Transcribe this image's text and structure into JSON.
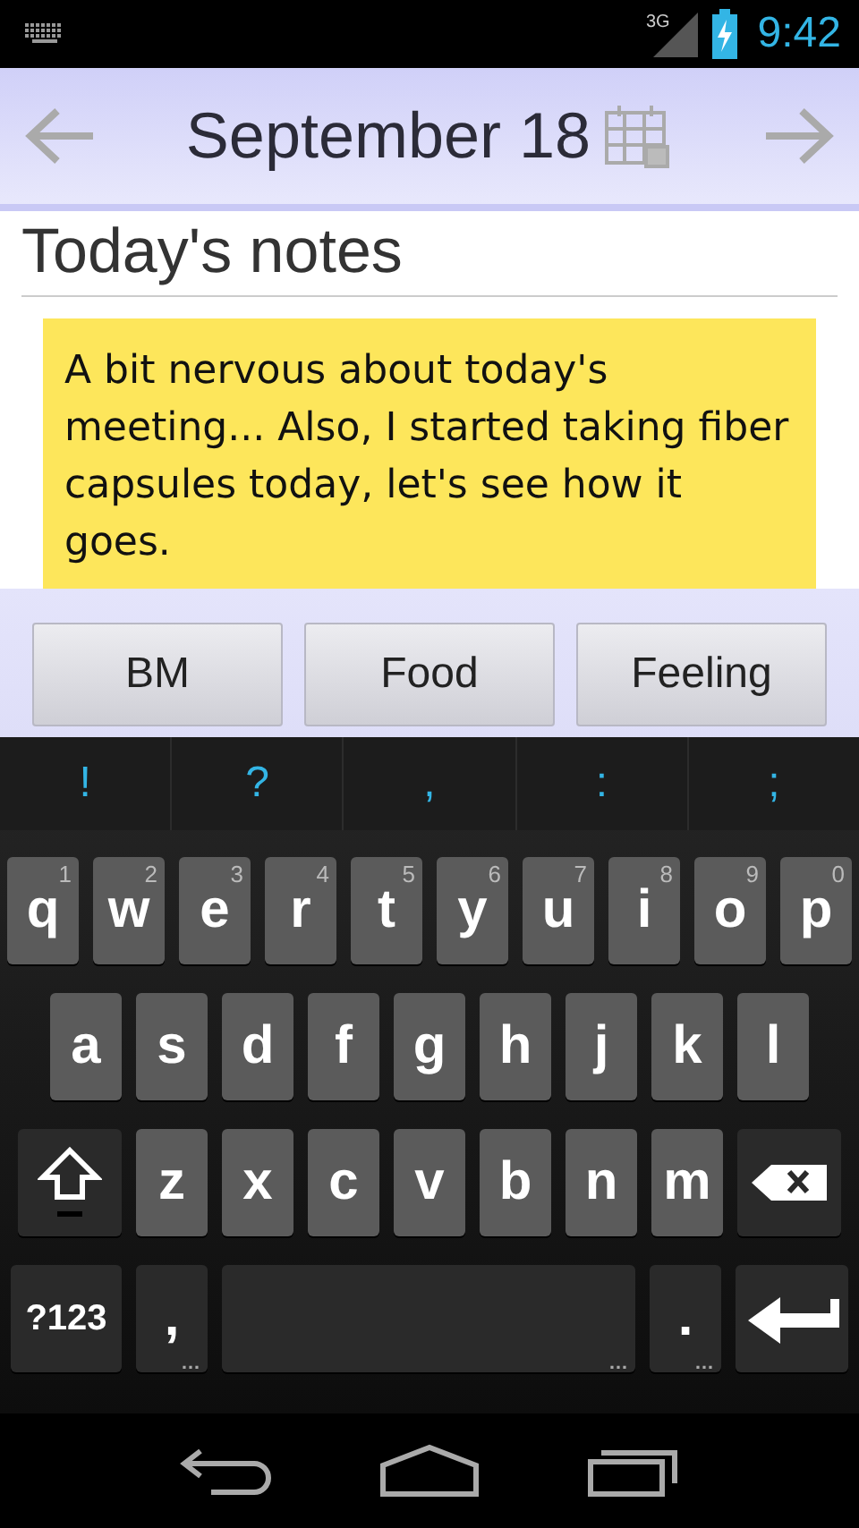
{
  "status_bar": {
    "time": "9:42",
    "network": "3G"
  },
  "header": {
    "title": "September 18"
  },
  "section_title": "Today's notes",
  "note": {
    "text": "A bit nervous about today's meeting... Also, I started taking fiber capsules today, let's see how it goes."
  },
  "category_buttons": [
    "BM",
    "Food",
    "Feeling"
  ],
  "suggestions": [
    "!",
    "?",
    ",",
    ":",
    ";"
  ],
  "keyboard": {
    "rows": [
      {
        "keys": [
          {
            "kind": "letter",
            "label": "q",
            "hint": "1"
          },
          {
            "kind": "letter",
            "label": "w",
            "hint": "2"
          },
          {
            "kind": "letter",
            "label": "e",
            "hint": "3"
          },
          {
            "kind": "letter",
            "label": "r",
            "hint": "4"
          },
          {
            "kind": "letter",
            "label": "t",
            "hint": "5"
          },
          {
            "kind": "letter",
            "label": "y",
            "hint": "6"
          },
          {
            "kind": "letter",
            "label": "u",
            "hint": "7"
          },
          {
            "kind": "letter",
            "label": "i",
            "hint": "8"
          },
          {
            "kind": "letter",
            "label": "o",
            "hint": "9"
          },
          {
            "kind": "letter",
            "label": "p",
            "hint": "0"
          }
        ]
      },
      {
        "keys": [
          {
            "kind": "letter",
            "label": "a"
          },
          {
            "kind": "letter",
            "label": "s"
          },
          {
            "kind": "letter",
            "label": "d"
          },
          {
            "kind": "letter",
            "label": "f"
          },
          {
            "kind": "letter",
            "label": "g"
          },
          {
            "kind": "letter",
            "label": "h"
          },
          {
            "kind": "letter",
            "label": "j"
          },
          {
            "kind": "letter",
            "label": "k"
          },
          {
            "kind": "letter",
            "label": "l"
          }
        ]
      },
      {
        "keys": [
          {
            "kind": "shift"
          },
          {
            "kind": "letter",
            "label": "z"
          },
          {
            "kind": "letter",
            "label": "x"
          },
          {
            "kind": "letter",
            "label": "c"
          },
          {
            "kind": "letter",
            "label": "v"
          },
          {
            "kind": "letter",
            "label": "b"
          },
          {
            "kind": "letter",
            "label": "n"
          },
          {
            "kind": "letter",
            "label": "m"
          },
          {
            "kind": "backspace"
          }
        ]
      },
      {
        "keys": [
          {
            "kind": "symbols",
            "label": "?123"
          },
          {
            "kind": "punct",
            "label": ",",
            "hint": "…"
          },
          {
            "kind": "space",
            "hint": "…"
          },
          {
            "kind": "punct",
            "label": ".",
            "hint": "…"
          },
          {
            "kind": "enter"
          }
        ]
      }
    ]
  }
}
